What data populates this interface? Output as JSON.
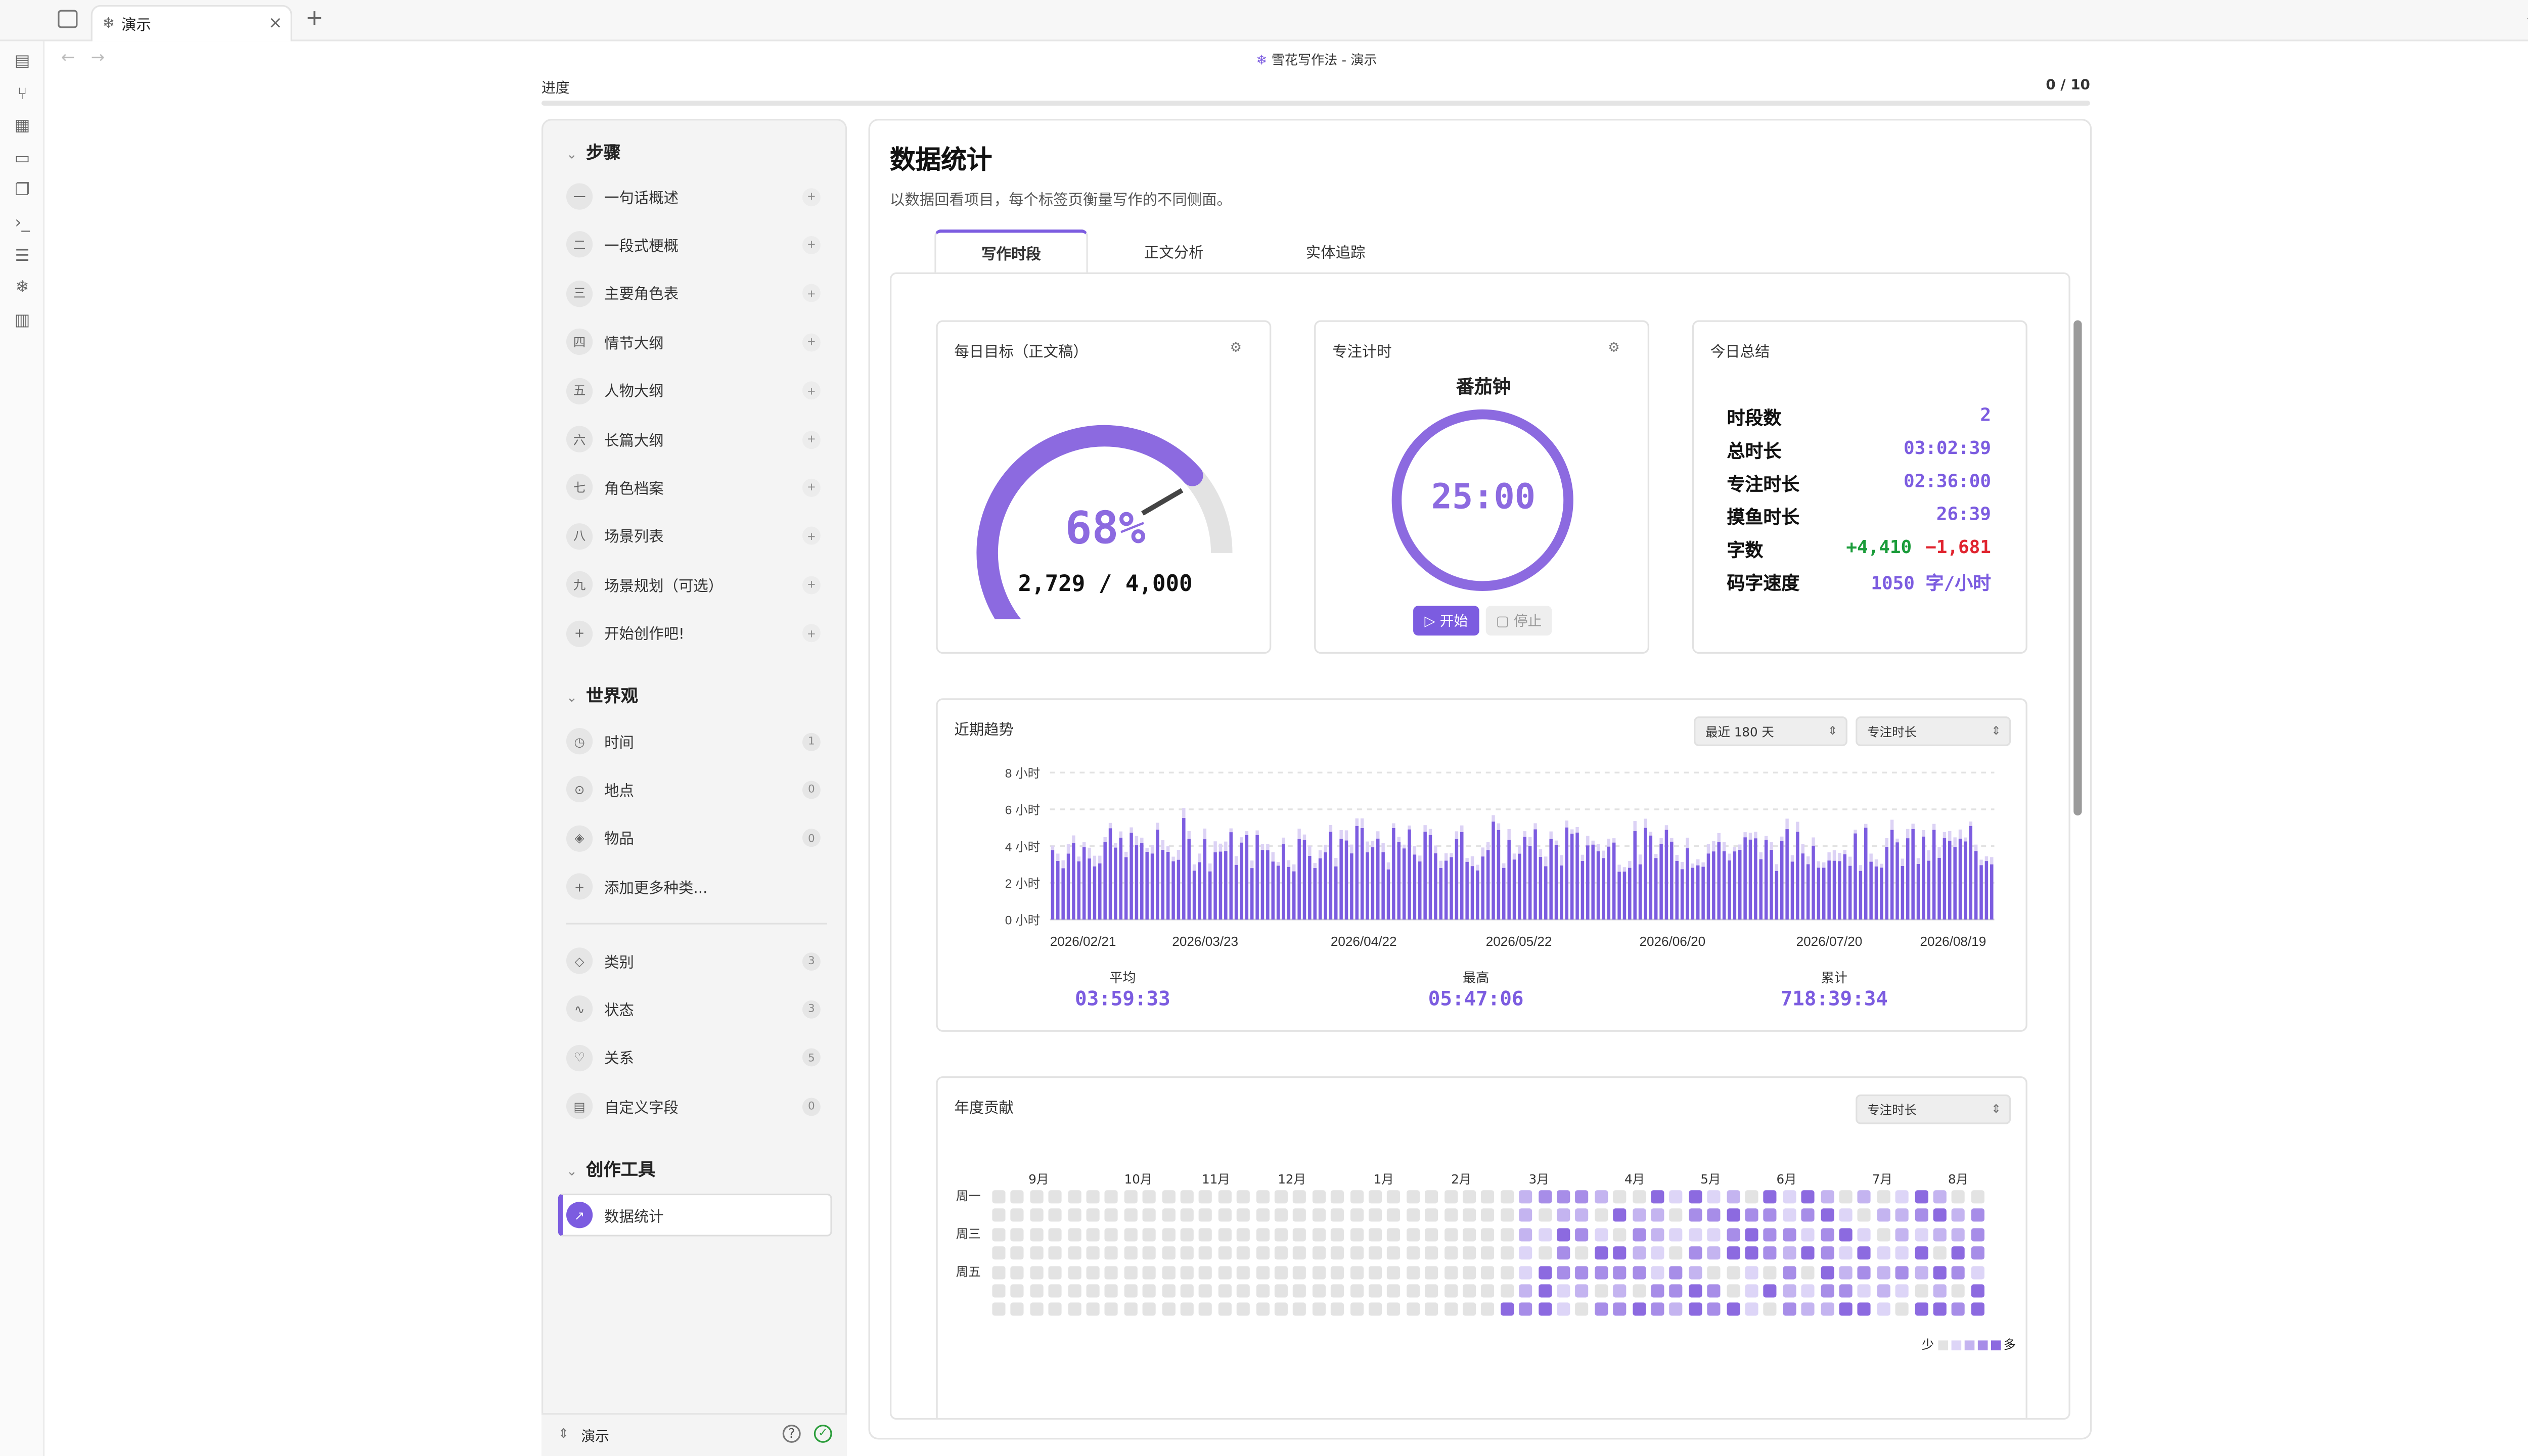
{
  "app": {
    "tab_title": "演示",
    "breadcrumb_icon": "❄",
    "breadcrumb": "雪花写作法 - 演示",
    "more": "···"
  },
  "progress": {
    "label": "进度",
    "count": "0 / 10",
    "value": 0
  },
  "sidebar": {
    "steps_title": "步骤",
    "steps": [
      {
        "icon": "一",
        "label": "一句话概述"
      },
      {
        "icon": "二",
        "label": "一段式梗概"
      },
      {
        "icon": "三",
        "label": "主要角色表"
      },
      {
        "icon": "四",
        "label": "情节大纲"
      },
      {
        "icon": "五",
        "label": "人物大纲"
      },
      {
        "icon": "六",
        "label": "长篇大纲"
      },
      {
        "icon": "七",
        "label": "角色档案"
      },
      {
        "icon": "八",
        "label": "场景列表"
      },
      {
        "icon": "九",
        "label": "场景规划（可选）"
      },
      {
        "icon": "+",
        "label": "开始创作吧!"
      }
    ],
    "world_title": "世界观",
    "world": [
      {
        "label": "时间",
        "count": "1"
      },
      {
        "label": "地点",
        "count": "0"
      },
      {
        "label": "物品",
        "count": "0"
      },
      {
        "label": "添加更多种类...",
        "count": ""
      }
    ],
    "meta": [
      {
        "label": "类别",
        "count": "3"
      },
      {
        "label": "状态",
        "count": "3"
      },
      {
        "label": "关系",
        "count": "5"
      },
      {
        "label": "自定义字段",
        "count": "0"
      }
    ],
    "tools_title": "创作工具",
    "tools": [
      {
        "label": "数据统计"
      }
    ],
    "vault_name": "演示"
  },
  "main": {
    "title": "数据统计",
    "subtitle": "以数据回看项目，每个标签页衡量写作的不同侧面。",
    "tabs": [
      "写作时段",
      "正文分析",
      "实体追踪"
    ],
    "active_tab": 0
  },
  "daily_goal": {
    "title": "每日目标（正文稿）",
    "percent": "68%",
    "fraction": 0.68,
    "progress_text": "2,729 / 4,000"
  },
  "focus_timer": {
    "title": "专注计时",
    "mode": "番茄钟",
    "time": "25:00",
    "start": "▷ 开始",
    "stop": "▢ 停止"
  },
  "today": {
    "title": "今日总结",
    "rows": [
      {
        "label": "时段数",
        "value": "2"
      },
      {
        "label": "总时长",
        "value": "03:02:39"
      },
      {
        "label": "专注时长",
        "value": "02:36:00"
      },
      {
        "label": "摸鱼时长",
        "value": "26:39"
      },
      {
        "label": "字数",
        "value_plus": "+4,410",
        "value_minus": "−1,681"
      },
      {
        "label": "码字速度",
        "value": "1050 字/小时"
      }
    ]
  },
  "trend": {
    "title": "近期趋势",
    "range_select": "最近 180 天",
    "metric_select": "专注时长",
    "avg_label": "平均",
    "avg": "03:59:33",
    "max_label": "最高",
    "max": "05:47:06",
    "total_label": "累计",
    "total": "718:39:34"
  },
  "chart_data": {
    "type": "bar",
    "ylabel": "",
    "y_ticks": [
      "0 小时",
      "2 小时",
      "4 小时",
      "6 小时",
      "8 小时"
    ],
    "ylim": [
      0,
      8
    ],
    "x_ticks": [
      "2026/02/21",
      "2026/03/23",
      "2026/04/22",
      "2026/05/22",
      "2026/06/20",
      "2026/07/20",
      "2026/08/19"
    ],
    "days": 180,
    "grid": true
  },
  "heatmap": {
    "title": "年度贡献",
    "metric_select": "专注时长",
    "months": [
      "9月",
      "10月",
      "11月",
      "12月",
      "1月",
      "2月",
      "3月",
      "4月",
      "5月",
      "6月",
      "7月",
      "8月"
    ],
    "weekdays": [
      "周一",
      "周三",
      "周五"
    ],
    "legend_less": "少",
    "legend_more": "多",
    "colors": [
      "#e3e3e3",
      "#ddd5f7",
      "#c4b4f0",
      "#a78de8",
      "#8c6ae0"
    ]
  },
  "colors": {
    "accent": "#7c5ce0",
    "plus": "#1a9c3a",
    "minus": "#e0242f"
  }
}
